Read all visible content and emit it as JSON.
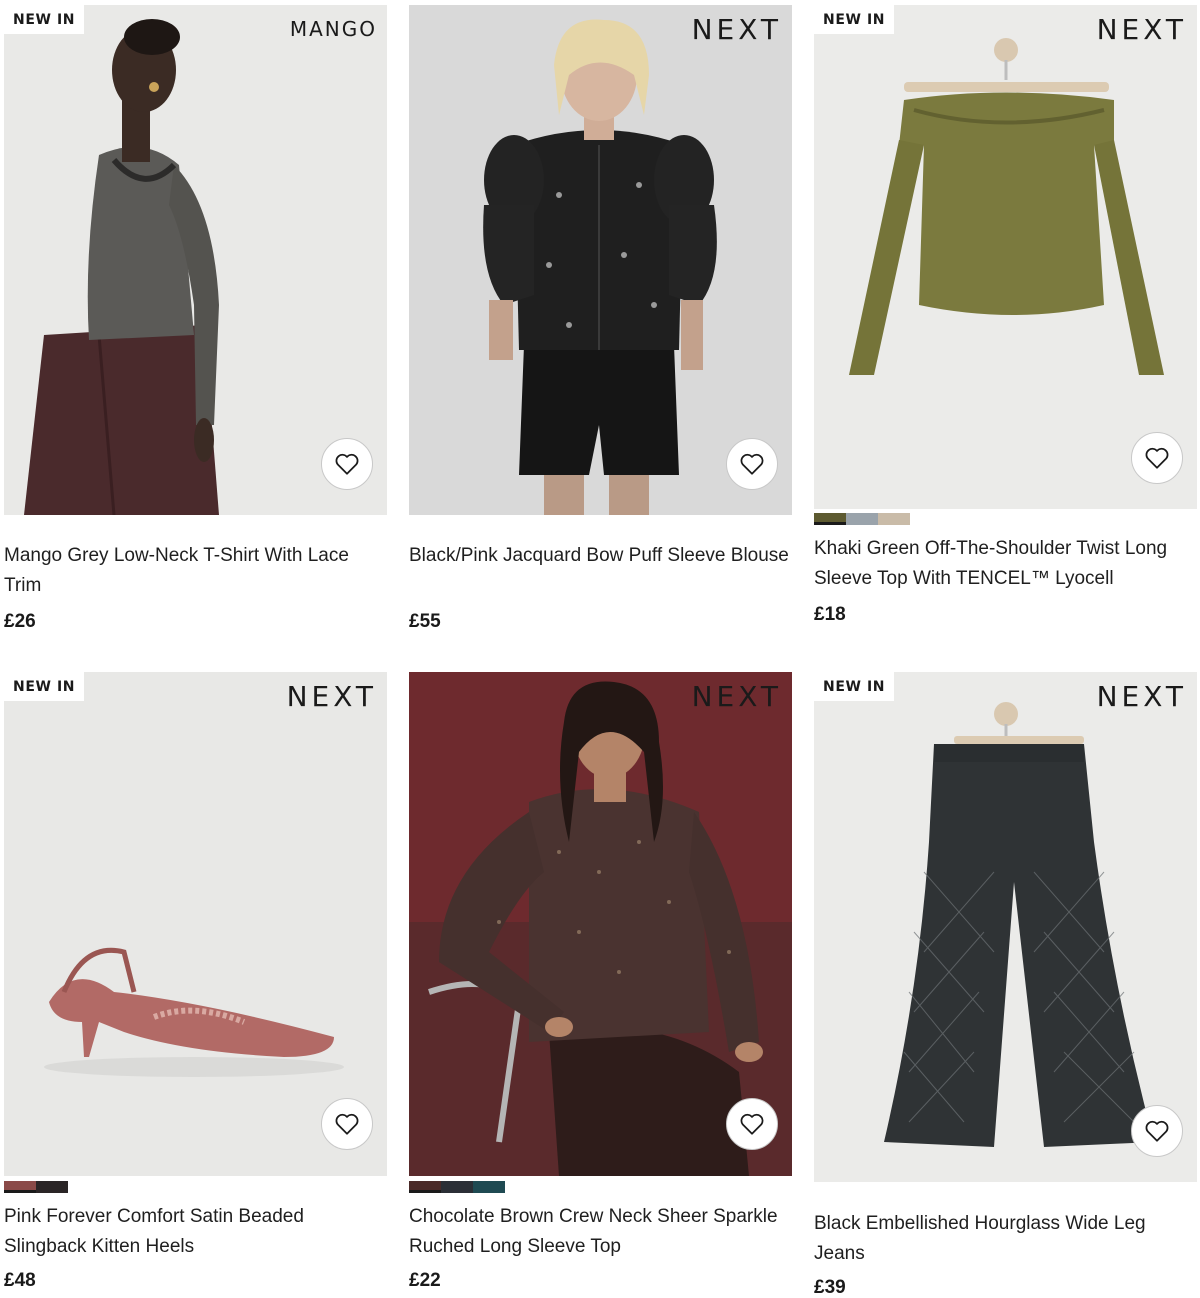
{
  "products": [
    {
      "badge": "NEW IN",
      "brand": "MANGO",
      "title": "Mango Grey Low-Neck T-Shirt With Lace Trim",
      "price": "£26",
      "swatches": []
    },
    {
      "badge": "",
      "brand": "NEXT",
      "title": "Black/Pink Jacquard Bow Puff Sleeve Blouse",
      "price": "£55",
      "swatches": []
    },
    {
      "badge": "NEW IN",
      "brand": "NEXT",
      "title": "Khaki Green Off-The-Shoulder Twist Long Sleeve Top With TENCEL™ Lyocell",
      "price": "£18",
      "swatches": [
        "#5d5a30",
        "#9aa3ab",
        "#c9bba8"
      ]
    },
    {
      "badge": "NEW IN",
      "brand": "NEXT",
      "title": "Pink Forever Comfort Satin Beaded Slingback Kitten Heels",
      "price": "£48",
      "swatches": [
        "#8a4a48",
        "#2a2526"
      ]
    },
    {
      "badge": "",
      "brand": "NEXT",
      "title": "Chocolate Brown Crew Neck Sheer Sparkle Ruched Long Sleeve Top",
      "price": "£22",
      "swatches": [
        "#4a2a28",
        "#2b2f36",
        "#1f4a52"
      ]
    },
    {
      "badge": "NEW IN",
      "brand": "NEXT",
      "title": "Black Embellished Hourglass Wide Leg Jeans",
      "price": "£39",
      "swatches": []
    }
  ],
  "icons": {
    "favourite": "heart-outline-icon"
  },
  "colors": {
    "text": "#1f1f1f",
    "badge_bg": "#ffffff",
    "fav_border": "#c8c8c8"
  }
}
